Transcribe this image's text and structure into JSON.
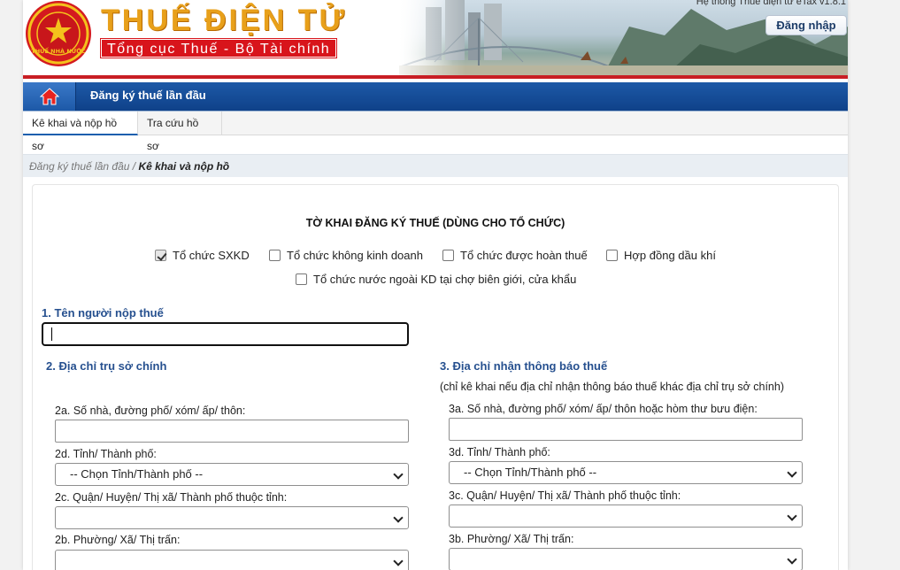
{
  "header": {
    "brand_title": "THUẾ ĐIỆN TỬ",
    "brand_subtitle": "Tổng cục Thuế - Bộ Tài chính",
    "emblem_text": "THUẾ NHÀ NƯỚC",
    "version": "Hệ thống Thuế điện tử eTax v1.8.1",
    "login_label": "Đăng nhập"
  },
  "nav": {
    "home_icon": "home-icon",
    "item": "Đăng ký thuế lần đầu"
  },
  "tabs": [
    {
      "label": "Kê khai và nộp hồ sơ",
      "active": true
    },
    {
      "label": "Tra cứu hồ sơ",
      "active": false
    }
  ],
  "breadcrumb": {
    "parent": "Đăng ký thuế lần đầu",
    "separator": "/",
    "current": "Kê khai và nộp hồ"
  },
  "form": {
    "title": "TỜ KHAI ĐĂNG KÝ THUẾ (DÙNG CHO TỔ CHỨC)",
    "org_types": [
      {
        "label": "Tổ chức SXKD",
        "checked": true
      },
      {
        "label": "Tổ chức không kinh doanh",
        "checked": false
      },
      {
        "label": "Tổ chức được hoàn thuế",
        "checked": false
      },
      {
        "label": "Hợp đồng dầu khí",
        "checked": false
      },
      {
        "label": "Tổ chức nước ngoài KD tại chợ biên giới, cửa khẩu",
        "checked": false
      }
    ],
    "taxpayer_name_label": "1. Tên người nộp thuế",
    "head_office": {
      "title": "2. Địa chỉ trụ sở chính",
      "street_label": "2a. Số nhà, đường phố/ xóm/ ấp/ thôn:",
      "province_label": "2d. Tỉnh/ Thành phố:",
      "province_value": "-- Chọn Tỉnh/Thành phố --",
      "district_label": "2c. Quận/ Huyện/ Thị xã/ Thành phố thuộc tỉnh:",
      "ward_label": "2b. Phường/ Xã/ Thị trấn:"
    },
    "notice_address": {
      "title": "3. Địa chỉ nhận thông báo thuế",
      "note": "(chỉ kê khai nếu địa chỉ nhận thông báo thuế khác địa chỉ trụ sở chính)",
      "street_label": "3a. Số nhà, đường phố/ xóm/ ấp/ thôn hoặc hòm thư bưu điện:",
      "province_label": "3d. Tỉnh/ Thành phố:",
      "province_value": "-- Chọn Tỉnh/Thành phố --",
      "district_label": "3c. Quận/ Huyện/ Thị xã/ Thành phố thuộc tỉnh:",
      "ward_label": "3b. Phường/ Xã/ Thị trấn:"
    }
  },
  "colors": {
    "nav_blue": "#1d59a7",
    "brand_gold": "#e8a01a",
    "brand_red": "#d8141b",
    "section_blue": "#26508f"
  }
}
